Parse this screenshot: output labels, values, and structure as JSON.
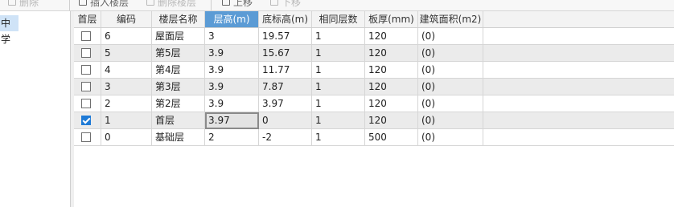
{
  "toolbar": {
    "delete_label": "删除",
    "insert_label": "插入楼层",
    "delete_floor_label": "删除楼层",
    "move_up_label": "上移",
    "move_down_label": "下移"
  },
  "left_panel": {
    "selected_item": "中学"
  },
  "table": {
    "columns": [
      "首层",
      "编码",
      "楼层名称",
      "层高(m)",
      "底标高(m)",
      "相同层数",
      "板厚(mm)",
      "建筑面积(m2)"
    ],
    "active_column": "层高(m)",
    "rows": [
      {
        "is_first": false,
        "code": "6",
        "name": "屋面层",
        "height": "3",
        "bottom_elevation": "19.57",
        "same_count": "1",
        "slab": "120",
        "area": "(0)"
      },
      {
        "is_first": false,
        "code": "5",
        "name": "第5层",
        "height": "3.9",
        "bottom_elevation": "15.67",
        "same_count": "1",
        "slab": "120",
        "area": "(0)"
      },
      {
        "is_first": false,
        "code": "4",
        "name": "第4层",
        "height": "3.9",
        "bottom_elevation": "11.77",
        "same_count": "1",
        "slab": "120",
        "area": "(0)"
      },
      {
        "is_first": false,
        "code": "3",
        "name": "第3层",
        "height": "3.9",
        "bottom_elevation": "7.87",
        "same_count": "1",
        "slab": "120",
        "area": "(0)"
      },
      {
        "is_first": false,
        "code": "2",
        "name": "第2层",
        "height": "3.9",
        "bottom_elevation": "3.97",
        "same_count": "1",
        "slab": "120",
        "area": "(0)"
      },
      {
        "is_first": true,
        "code": "1",
        "name": "首层",
        "height": "3.97",
        "bottom_elevation": "0",
        "same_count": "1",
        "slab": "120",
        "area": "(0)"
      },
      {
        "is_first": false,
        "code": "0",
        "name": "基础层",
        "height": "2",
        "bottom_elevation": "-2",
        "same_count": "1",
        "slab": "500",
        "area": "(0)"
      }
    ],
    "selected_cell": {
      "row": 5,
      "column": "height"
    }
  }
}
